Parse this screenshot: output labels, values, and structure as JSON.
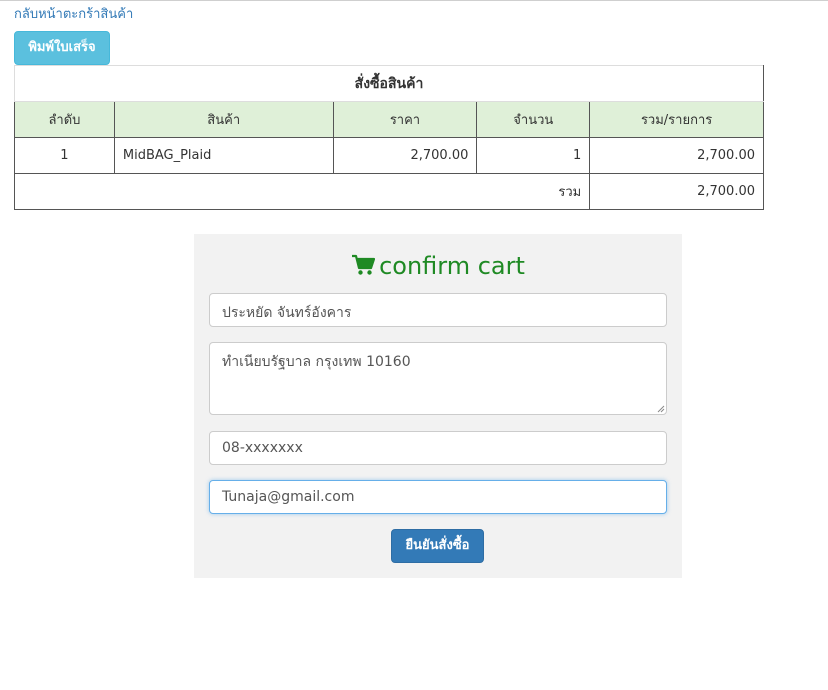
{
  "nav": {
    "back_link": "กลับหน้าตะกร้าสินค้า"
  },
  "toolbar": {
    "print_label": "พิมพ์ใบเสร็จ"
  },
  "order_table": {
    "caption": "สั่งซื้อสินค้า",
    "headers": [
      "ลำดับ",
      "สินค้า",
      "ราคา",
      "จำนวน",
      "รวม/รายการ"
    ],
    "rows": [
      {
        "no": "1",
        "product": "MidBAG_Plaid",
        "price": "2,700.00",
        "qty": "1",
        "subtotal": "2,700.00"
      }
    ],
    "total_label": "รวม",
    "total_value": "2,700.00",
    "header_bg": "#dff0d8"
  },
  "confirm_form": {
    "title": "confirm cart",
    "title_icon": "shopping-cart-icon",
    "title_color": "#1f8a24",
    "name_value": "ประหยัด จันทร์อังคาร",
    "address_value": "ทำเนียบรัฐบาล กรุงเทพ 10160",
    "phone_value": "08-xxxxxxx",
    "email_value": "Tunaja@gmail.com",
    "submit_label": "ยืนยันสั่งซื้อ",
    "panel_bg": "#f2f2f2"
  },
  "colors": {
    "link": "#337ab7",
    "info_button": "#5bc0de",
    "primary_button": "#337ab7"
  }
}
